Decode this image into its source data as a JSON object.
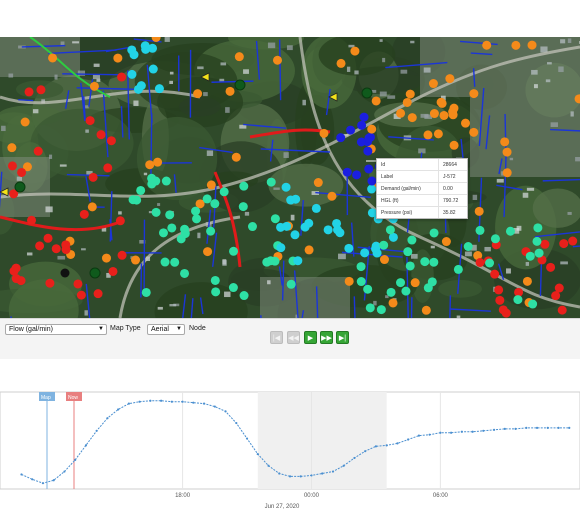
{
  "map": {
    "type": "Aerial",
    "node_colors": {
      "red": "#e8201b",
      "orange": "#f48a1a",
      "teal": "#2ee0a5",
      "cyan": "#22d3e6",
      "blue": "#1b1fe0"
    },
    "pipe_colors": {
      "red": "#e01b1b",
      "blue": "#1b35d8",
      "green": "#2ecc40"
    }
  },
  "popup": {
    "rows": [
      {
        "label": "Id",
        "value": "28664"
      },
      {
        "label": "Label",
        "value": "J-572"
      },
      {
        "label": "Demand (gal/min)",
        "value": "0.00"
      },
      {
        "label": "HGL (ft)",
        "value": "790.72"
      },
      {
        "label": "Pressure (psi)",
        "value": "35.82"
      }
    ]
  },
  "controls": {
    "variable_select": "Flow (gal/min)",
    "map_type_label": "Map Type",
    "map_type_select": "Aerial",
    "node_label": "Node",
    "playback": [
      {
        "icon": "skip-back-icon",
        "glyph": "|◀",
        "enabled": false
      },
      {
        "icon": "step-back-icon",
        "glyph": "◀◀",
        "enabled": false
      },
      {
        "icon": "play-icon",
        "glyph": "▶",
        "enabled": true
      },
      {
        "icon": "fast-forward-icon",
        "glyph": "▶▶",
        "enabled": true
      },
      {
        "icon": "skip-end-icon",
        "glyph": "▶|",
        "enabled": true
      }
    ]
  },
  "chart": {
    "markers": {
      "map_label": "Map",
      "now_label": "Now",
      "map_color": "#7fb3e0",
      "now_color": "#e87f7f"
    },
    "date_label": "Jun 27, 2020",
    "line_color": "#4a8fd0"
  },
  "chart_data": {
    "type": "line",
    "x_ticks": [
      "18:00",
      "00:00",
      "06:00"
    ],
    "x_hours": [
      10.5,
      11.0,
      11.5,
      12.0,
      12.5,
      13.0,
      13.5,
      14.0,
      14.5,
      15.0,
      15.5,
      16.0,
      16.5,
      17.0,
      17.5,
      18.0,
      18.5,
      19.0,
      19.5,
      20.0,
      20.5,
      21.0,
      21.5,
      22.0,
      22.5,
      23.0,
      23.5,
      24.0,
      24.5,
      25.0,
      25.5,
      26.0,
      26.5,
      27.0,
      27.5,
      28.0,
      28.5,
      29.0,
      29.5,
      30.0,
      30.5,
      31.0,
      31.5,
      32.0,
      32.5,
      33.0,
      33.5,
      34.0,
      34.5,
      35.0,
      35.5,
      36.0
    ],
    "values": [
      0.15,
      0.1,
      0.06,
      0.09,
      0.18,
      0.3,
      0.45,
      0.6,
      0.73,
      0.82,
      0.88,
      0.9,
      0.91,
      0.91,
      0.9,
      0.9,
      0.89,
      0.88,
      0.85,
      0.8,
      0.68,
      0.52,
      0.36,
      0.24,
      0.16,
      0.13,
      0.13,
      0.14,
      0.16,
      0.18,
      0.24,
      0.32,
      0.39,
      0.44,
      0.45,
      0.47,
      0.51,
      0.55,
      0.56,
      0.58,
      0.58,
      0.59,
      0.59,
      0.6,
      0.61,
      0.62,
      0.62,
      0.63,
      0.63,
      0.63,
      0.63,
      0.63
    ],
    "ylim": [
      0,
      1
    ],
    "grid": true,
    "shaded_regions": [
      [
        21.5,
        27.5
      ]
    ],
    "series": [
      {
        "values_ref": "values"
      }
    ]
  }
}
